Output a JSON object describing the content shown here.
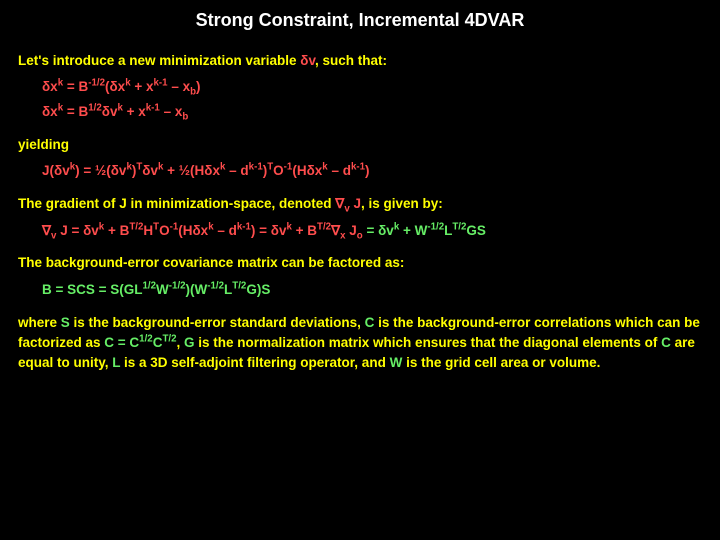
{
  "title": "Strong Constraint, Incremental 4DVAR",
  "intro": {
    "p1a": "Let's introduce a new minimization variable ",
    "p1b": ", such that:"
  },
  "eq1": {
    "a": "δx",
    "b": "k",
    "c": " = B",
    "d": "-1/2",
    "e": "(δx",
    "f": "k",
    "g": " + x",
    "h": "k-1",
    "i": " – x",
    "j": "b",
    "k": ")"
  },
  "eq2": {
    "a": "δx",
    "b": "k",
    "c": " = B",
    "d": "1/2",
    "e": "δv",
    "f": "k",
    "g": " + x",
    "h": "k-1",
    "i": " – x",
    "j": "b"
  },
  "yielding": "yielding",
  "eq3": {
    "a": "J(δv",
    "b": "k",
    "c": ") = ½(δv",
    "d": "k",
    "e": ")",
    "f": "T",
    "g": "δv",
    "h": "k",
    "i": " + ½(Hδx",
    "j": "k",
    "k": " – d",
    "l": "k-1",
    "m": ")",
    "n": "T",
    "o": "O",
    "p": "-1",
    "q": "(Hδx",
    "r": "k",
    "s": " – d",
    "t": "k-1",
    "u": ")"
  },
  "grad": {
    "a": "The gradient of J in minimization-space, denoted ",
    "b": "∇",
    "c": "v",
    "d": " J",
    "e": ", is given by:"
  },
  "eq4": {
    "a": "∇",
    "b": "v",
    "c": " J = δv",
    "d": "k",
    "e": " + B",
    "f": "T/2",
    "g": "H",
    "h": "T",
    "i": "O",
    "j": "-1",
    "k": "(Hδx",
    "l": "k",
    "m": " – d",
    "n": "k-1",
    "o": ") = δv",
    "p": "k",
    "q": " + B",
    "r": "T/2",
    "s": "∇",
    "t": "x",
    "u": " J",
    "v": "o",
    "w": " = δv",
    "x": "k",
    "y": " + W",
    "z": "-1/2",
    "aa": "L",
    "ab": "T/2",
    "ac": "GS"
  },
  "bg": "The background-error covariance matrix can be factored as:",
  "eq5": {
    "a": "B = SCS = S(GL",
    "b": "1/2",
    "c": "W",
    "d": "-1/2",
    "e": ")(W",
    "f": "-1/2",
    "g": "L",
    "h": "T/2",
    "i": "G)S"
  },
  "para": {
    "a": "where ",
    "b": "S",
    "c": " is the background-error standard deviations, ",
    "d": "C",
    "e": " is the background-error correlations which can be factorized as ",
    "f": "C = C",
    "g": "1/2",
    "h": "C",
    "i": "T/2",
    "j": ", ",
    "k": "G",
    "l": " is the normalization matrix which ensures that the diagonal elements of ",
    "m": "C",
    "n": " are equal to unity, ",
    "o": "L",
    "p": " is a 3D self-adjoint filtering operator, and ",
    "q": "W",
    "r": " is the grid cell area or volume."
  },
  "dv": "δv"
}
